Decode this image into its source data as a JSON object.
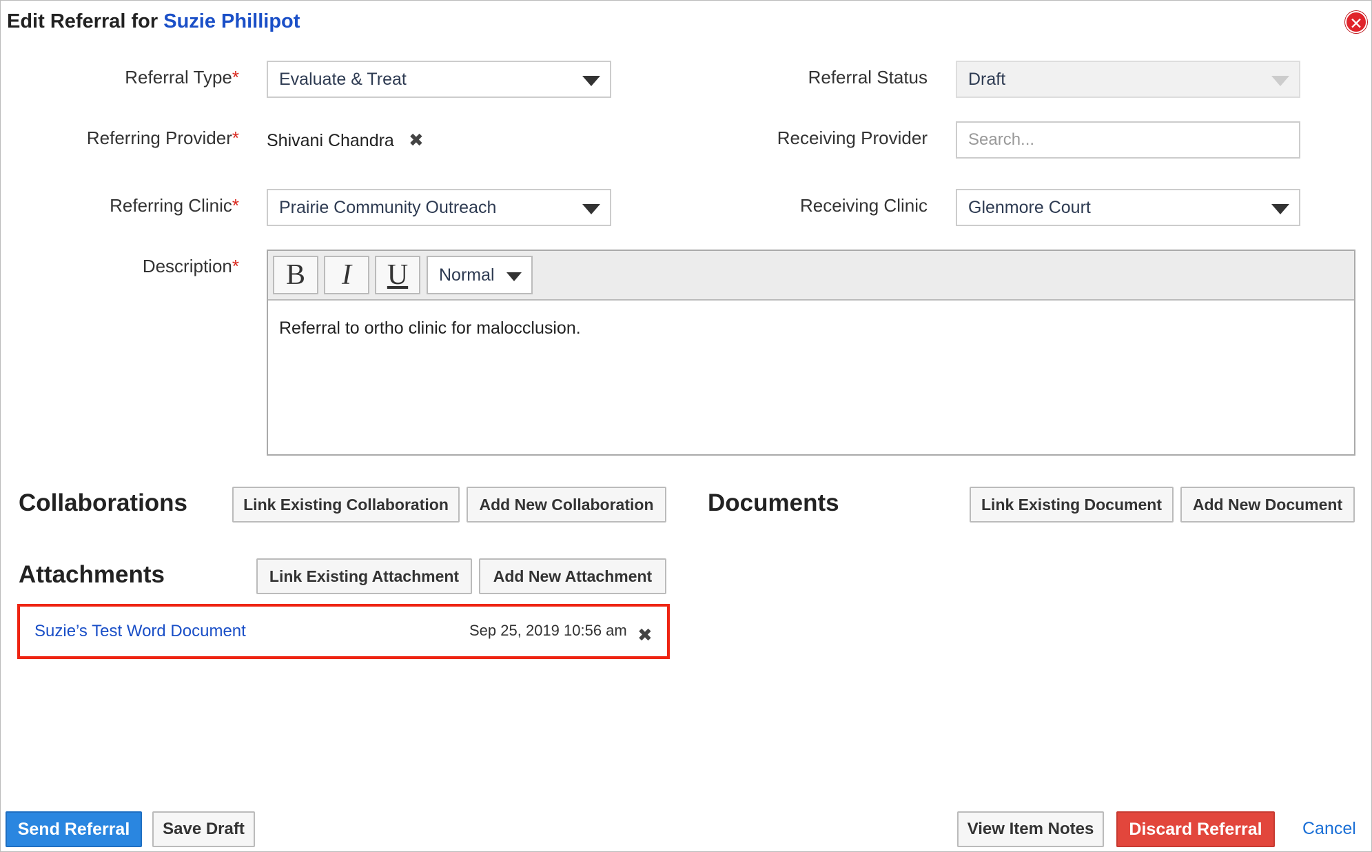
{
  "header": {
    "title_prefix": "Edit Referral for",
    "patient_name": "Suzie Phillipot",
    "close_icon": "close-circle-icon"
  },
  "form": {
    "referral_type": {
      "label": "Referral Type",
      "value": "Evaluate & Treat"
    },
    "referring_provider": {
      "label": "Referring Provider",
      "value": "Shivani Chandra"
    },
    "referring_clinic": {
      "label": "Referring Clinic",
      "value": "Prairie Community Outreach"
    },
    "description": {
      "label": "Description",
      "text": "Referral to ortho clinic for malocclusion."
    },
    "referral_status": {
      "label": "Referral Status",
      "value": "Draft"
    },
    "receiving_provider": {
      "label": "Receiving Provider",
      "placeholder": "Search..."
    },
    "receiving_clinic": {
      "label": "Receiving Clinic",
      "value": "Glenmore Court"
    },
    "required_marker": "*"
  },
  "editor_toolbar": {
    "bold": "B",
    "italic": "I",
    "underline": "U",
    "format_value": "Normal"
  },
  "sections": {
    "collaborations": {
      "title": "Collaborations",
      "link_button": "Link Existing Collaboration",
      "add_button": "Add New Collaboration"
    },
    "documents": {
      "title": "Documents",
      "link_button": "Link Existing Document",
      "add_button": "Add New Document"
    },
    "attachments": {
      "title": "Attachments",
      "link_button": "Link Existing Attachment",
      "add_button": "Add New Attachment",
      "items": [
        {
          "name": "Suzie’s Test Word Document",
          "date": "Sep 25, 2019 10:56 am"
        }
      ]
    }
  },
  "footer": {
    "send": "Send Referral",
    "save_draft": "Save Draft",
    "view_notes": "View Item Notes",
    "discard": "Discard Referral",
    "cancel": "Cancel"
  },
  "colors": {
    "accent_link": "#1a4fc7",
    "primary_button": "#2a86e0",
    "danger_button": "#e2463c",
    "highlight_border": "#ee2412",
    "required": "#d9281e"
  }
}
